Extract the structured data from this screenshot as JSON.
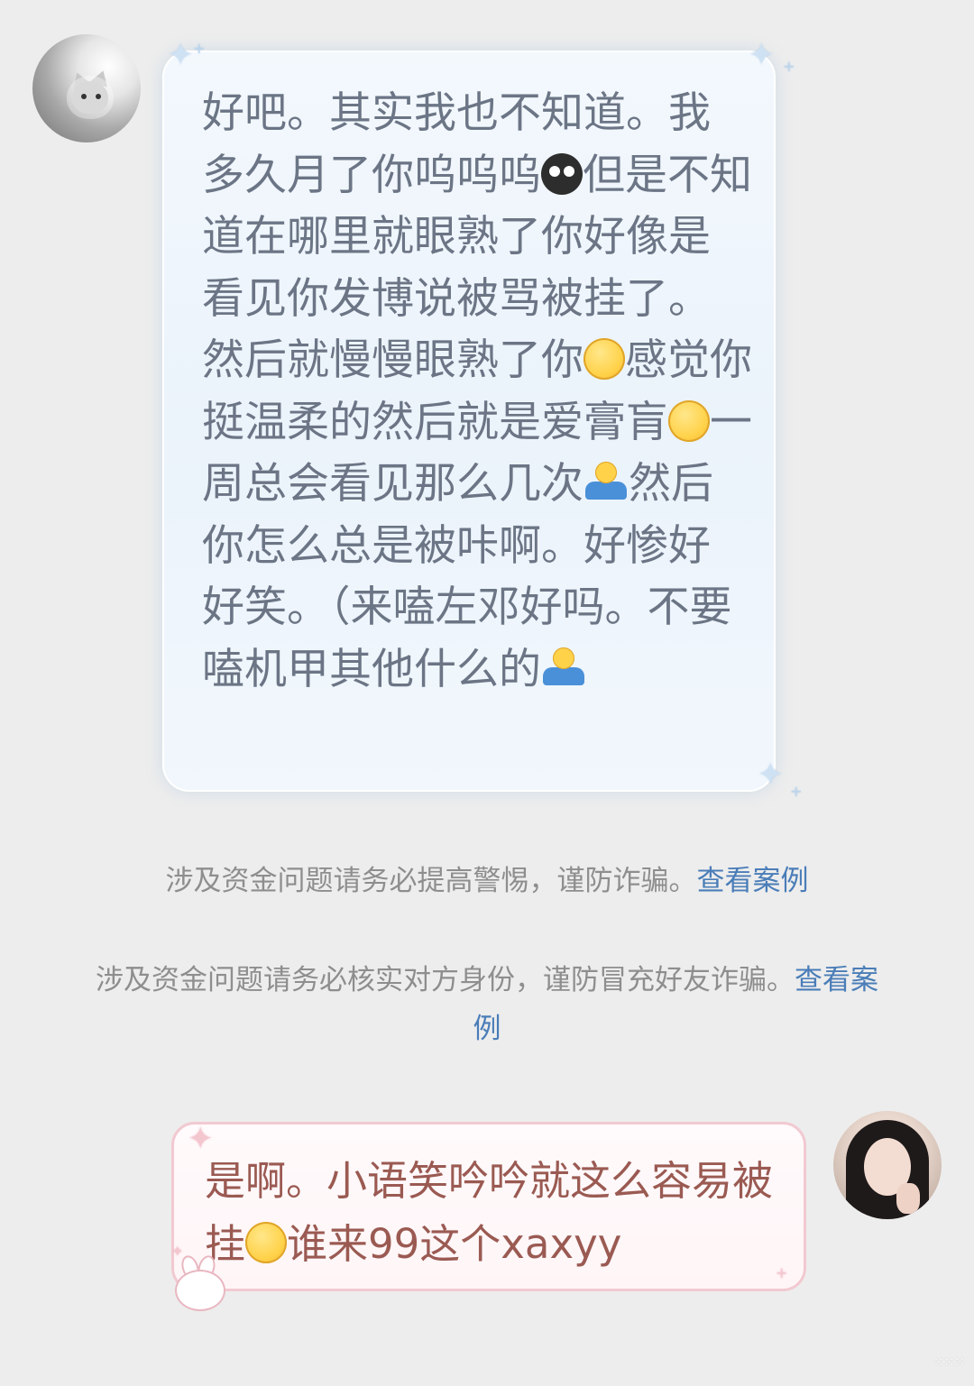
{
  "conversation": {
    "incoming": {
      "avatar_icon": "cat-avatar-icon",
      "segments": [
        {
          "t": "好吧。其实我也不知道。我多久月了你呜呜呜"
        },
        {
          "emoji": "cry"
        },
        {
          "t": "但是不知道在哪里就眼熟了你好像是看见你发博说被骂被挂了。然后就慢慢眼熟了你"
        },
        {
          "emoji": "yellow"
        },
        {
          "t": "感觉你挺温柔的然后就是爱膏肓"
        },
        {
          "emoji": "yellow"
        },
        {
          "t": "一周总会看见那么几次"
        },
        {
          "emoji": "shrug"
        },
        {
          "t": "然后你怎么总是被咔啊。好惨好好笑。（来嗑左邓好吗。不要嗑机甲其他什么的"
        },
        {
          "emoji": "shrug"
        }
      ],
      "bubble_accent": "#ebf3fb"
    },
    "notices": [
      {
        "text": "涉及资金问题请务必提高警惕，谨防诈骗。",
        "link": "查看案例"
      },
      {
        "text": "涉及资金问题请务必核实对方身份，谨防冒充好友诈骗。",
        "link": "查看案例"
      }
    ],
    "outgoing": {
      "avatar_icon": "girl-avatar-icon",
      "segments": [
        {
          "t": "是啊。小语笑吟吟就这么容易被挂"
        },
        {
          "emoji": "yellow"
        },
        {
          "t": "谁来99这个xaxyy"
        }
      ],
      "bubble_accent": "#f2c9d1"
    }
  },
  "colors": {
    "background": "#ededed",
    "incoming_text": "#6b7585",
    "outgoing_text": "#9a5a52",
    "notice_text": "#8e8e8e",
    "link": "#4a7db8"
  }
}
